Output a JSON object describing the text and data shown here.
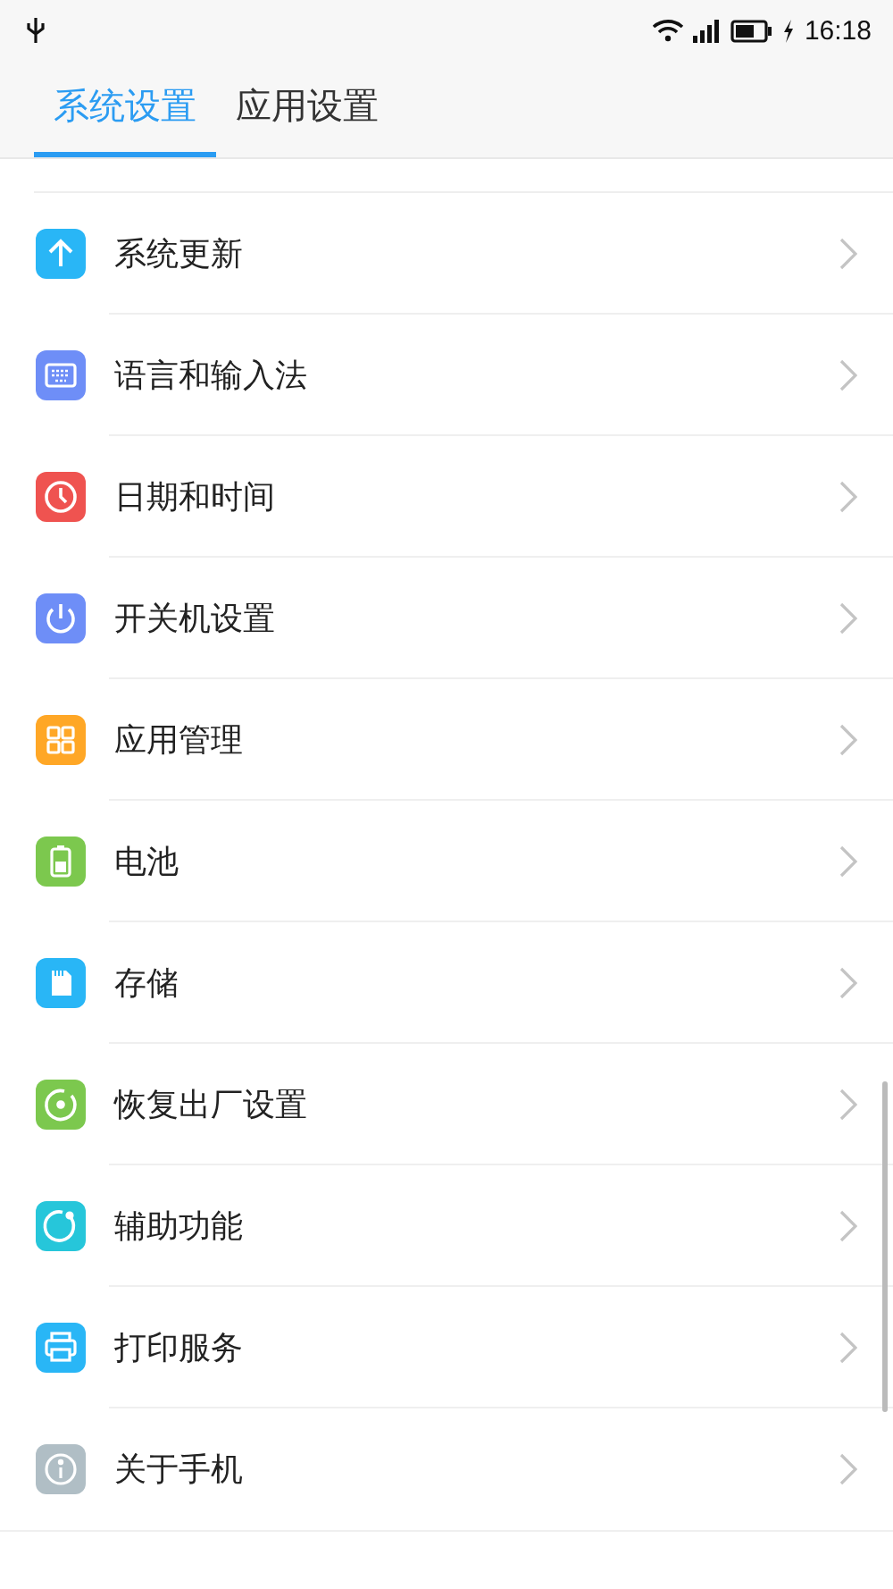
{
  "status_bar": {
    "time": "16:18"
  },
  "tabs": [
    {
      "label": "系统设置",
      "selected": true
    },
    {
      "label": "应用设置",
      "selected": false
    }
  ],
  "items": [
    {
      "label": "系统更新",
      "kind": "up",
      "color": "#29b6f6"
    },
    {
      "label": "语言和输入法",
      "kind": "keyboard",
      "color": "#6e8ef7"
    },
    {
      "label": "日期和时间",
      "kind": "clock",
      "color": "#ef5350"
    },
    {
      "label": "开关机设置",
      "kind": "power",
      "color": "#6e8ef7"
    },
    {
      "label": "应用管理",
      "kind": "grid",
      "color": "#ffa726"
    },
    {
      "label": "电池",
      "kind": "battery",
      "color": "#7cc84e"
    },
    {
      "label": "存储",
      "kind": "sd",
      "color": "#29b6f6"
    },
    {
      "label": "恢复出厂设置",
      "kind": "reset",
      "color": "#7cc84e"
    },
    {
      "label": "辅助功能",
      "kind": "ring",
      "color": "#26c6da"
    },
    {
      "label": "打印服务",
      "kind": "printer",
      "color": "#29b6f6"
    },
    {
      "label": "关于手机",
      "kind": "info",
      "color": "#b0bec5"
    }
  ]
}
